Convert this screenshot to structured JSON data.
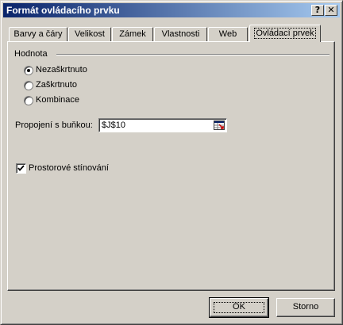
{
  "window": {
    "title": "Formát ovládacího prvku",
    "help_glyph": "?",
    "close_glyph": "✕"
  },
  "tabs": [
    {
      "label": "Barvy a čáry",
      "active": false
    },
    {
      "label": "Velikost",
      "active": false
    },
    {
      "label": "Zámek",
      "active": false
    },
    {
      "label": "Vlastnosti",
      "active": false
    },
    {
      "label": "Web",
      "active": false
    },
    {
      "label": "Ovládací prvek",
      "active": true
    }
  ],
  "value_group": {
    "label": "Hodnota",
    "options": [
      {
        "label": "Nezaškrtnuto",
        "selected": true
      },
      {
        "label": "Zaškrtnuto",
        "selected": false
      },
      {
        "label": "Kombinace",
        "selected": false
      }
    ]
  },
  "cell_link": {
    "label": "Propojení s buňkou:",
    "value": "$J$10",
    "ref_icon": "range-select-icon"
  },
  "shading": {
    "label": "Prostorové stínování",
    "checked": true
  },
  "buttons": {
    "ok": "OK",
    "cancel": "Storno"
  },
  "colors": {
    "face": "#d4d0c8",
    "title_start": "#0a246a",
    "title_end": "#a6caf0"
  }
}
